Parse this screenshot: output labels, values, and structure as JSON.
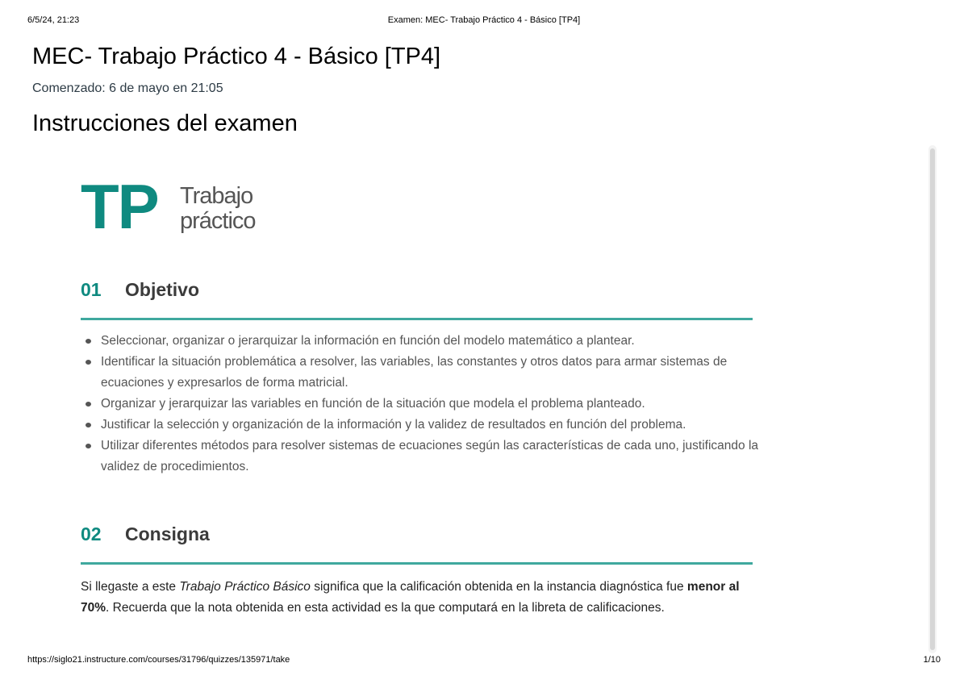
{
  "print_header": {
    "datetime": "6/5/24, 21:23",
    "document_title": "Examen: MEC- Trabajo Práctico 4 - Básico [TP4]"
  },
  "print_footer": {
    "url": "https://siglo21.instructure.com/courses/31796/quizzes/135971/take",
    "page": "1/10"
  },
  "quiz": {
    "title": "MEC- Trabajo Práctico 4 - Básico [TP4]",
    "started": "Comenzado: 6 de mayo en 21:05",
    "instructions_heading": "Instrucciones del examen"
  },
  "logo": {
    "mark": "TP",
    "word_line1": "Trabajo",
    "word_line2": "práctico",
    "color": "#0f8a80"
  },
  "sections": {
    "objetivo": {
      "number": "01",
      "label": "Objetivo",
      "items": [
        "Seleccionar, organizar o jerarquizar la información en función del modelo matemático a plantear.",
        "Identificar la situación problemática a resolver, las variables, las constantes y otros datos para armar sistemas de ecuaciones y expresarlos de forma matricial.",
        "Organizar y jerarquizar las variables en función de la situación que modela el problema planteado.",
        "Justificar la selección y organización de la información y la validez de resultados en función del problema.",
        "Utilizar diferentes métodos para resolver sistemas de ecuaciones según las características de cada uno, justificando la validez de procedimientos."
      ]
    },
    "consigna": {
      "number": "02",
      "label": "Consigna",
      "text_part1": "Si llegaste a este ",
      "text_italic": "Trabajo Práctico Básico",
      "text_part2": " significa que la calificación obtenida en la instancia diagnóstica fue ",
      "text_bold": "menor al 70%",
      "text_part3": ". Recuerda que la nota obtenida en esta actividad es la que computará en la libreta de calificaciones."
    }
  },
  "colors": {
    "accent": "#0f8a80",
    "rule": "#3fa89e"
  }
}
